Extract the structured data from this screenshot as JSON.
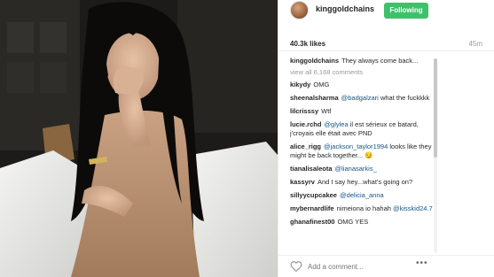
{
  "post": {
    "username": "kinggoldchains",
    "follow_label": "Following",
    "likes": "40.3k likes",
    "time": "45m",
    "caption_user": "kinggoldchains",
    "caption_text": "They always come back...",
    "view_all": "view all 6,168 comments"
  },
  "comments": [
    {
      "user": "kikydy",
      "pre": "OMG",
      "mention": "",
      "post": ""
    },
    {
      "user": "sheenalsharma",
      "pre": "",
      "mention": "@badgalzari",
      "post": "what the fuckkkk"
    },
    {
      "user": "lilcrisssy",
      "pre": "Wtf",
      "mention": "",
      "post": ""
    },
    {
      "user": "lucie.rchd",
      "pre": "",
      "mention": "@glylea",
      "post": "il est sérieux ce batard, j'croyais elle était avec PND"
    },
    {
      "user": "alice_rigg",
      "pre": "",
      "mention": "@jackson_taylor1994",
      "post": "looks like they might be back together... 😏"
    },
    {
      "user": "tianalisaleota",
      "pre": "",
      "mention": "@lianasarkis_",
      "post": ""
    },
    {
      "user": "kassyrv",
      "pre": "And I say hey...what's going on?",
      "mention": "",
      "post": ""
    },
    {
      "user": "sillyycupcakee",
      "pre": "",
      "mention": "@delicia_anna",
      "post": ""
    },
    {
      "user": "mybernardlife",
      "pre": "nimeiona io hahah",
      "mention": "@kisskid24.7",
      "post": ""
    },
    {
      "user": "ghanafinest00",
      "pre": "OMG YES",
      "mention": "",
      "post": ""
    }
  ],
  "footer": {
    "add_comment_placeholder": "Add a comment...",
    "more_label": "•••",
    "heart_icon": "heart-outline-icon"
  },
  "colors": {
    "follow_green": "#3dc26b",
    "mention_blue": "#125688"
  }
}
